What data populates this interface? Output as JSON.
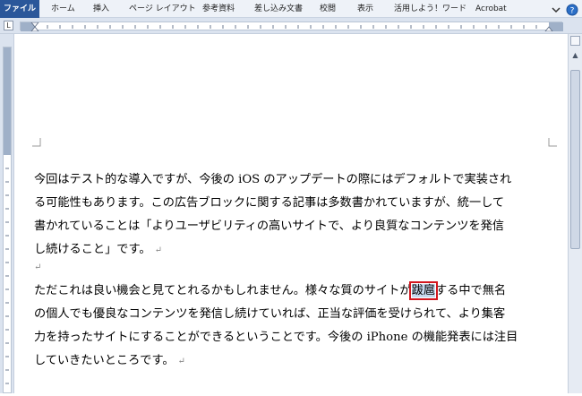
{
  "ribbon": {
    "tabs": [
      {
        "label": "ファイル"
      },
      {
        "label": "ホーム"
      },
      {
        "label": "挿入"
      },
      {
        "label": "ページ レイアウト"
      },
      {
        "label": "参考資料"
      },
      {
        "label": "差し込み文書"
      },
      {
        "label": "校閲"
      },
      {
        "label": "表示"
      },
      {
        "label": "活用しよう！ワード"
      },
      {
        "label": "Acrobat"
      }
    ]
  },
  "ruler": {
    "tab_selector": "L"
  },
  "document": {
    "paragraph1": {
      "lines": [
        "今回はテスト的な導入ですが、今後の iOS のアップデートの際にはデフォルトで実装され",
        "る可能性もあります。この広告ブロックに関する記事は多数書かれていますが、統一して",
        "書かれていることは「よりユーザビリティの高いサイトで、より良質なコンテンツを発信",
        "し続けること」です。"
      ]
    },
    "paragraph2": {
      "line1_before": "ただこれは良い機会と見てとれるかもしれません。様々な質のサイトが",
      "line1_selected": "跋扈",
      "line1_after": "する中で無名",
      "lines": [
        "の個人でも優良なコンテンツを発信し続けていれば、正当な評価を受けられて、より集客",
        "力を持ったサイトにすることができるということです。今後の iPhone の機能発表には注目",
        "していきたいところです。"
      ]
    },
    "paragraph_mark": "↵"
  },
  "colors": {
    "file_tab": "#2b579a",
    "selection_outline": "#d2161e",
    "selection_fill": "#c7d9ee"
  }
}
